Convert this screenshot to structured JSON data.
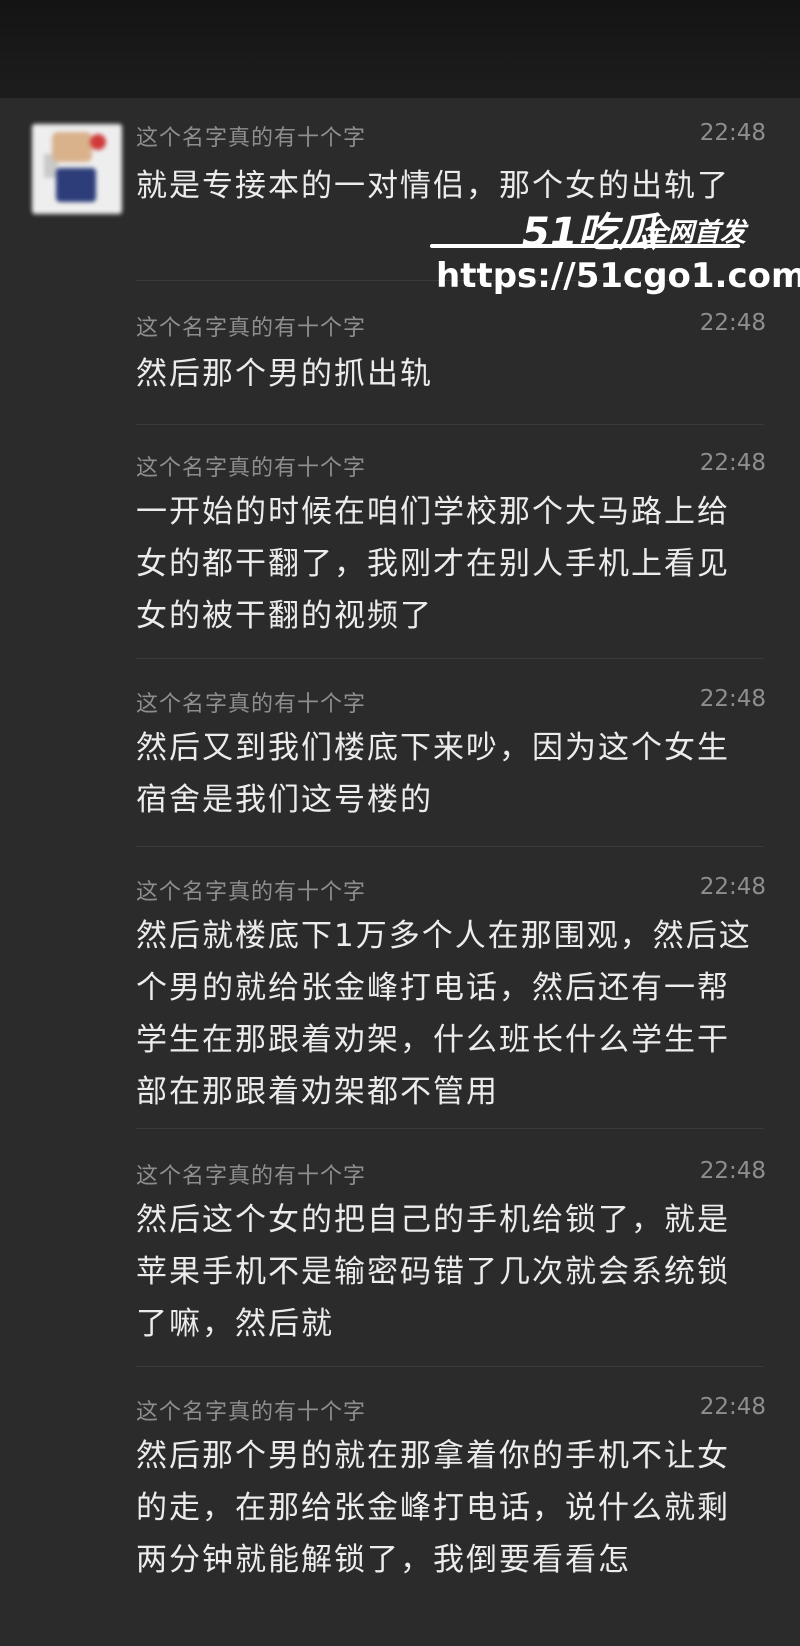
{
  "messages": [
    {
      "sender": "这个名字真的有十个字",
      "time": "22:48",
      "text": "就是专接本的一对情侣，那个女的出轨了"
    },
    {
      "sender": "这个名字真的有十个字",
      "time": "22:48",
      "text": "然后那个男的抓出轨"
    },
    {
      "sender": "这个名字真的有十个字",
      "time": "22:48",
      "text": "一开始的时候在咱们学校那个大马路上给女的都干翻了，我刚才在别人手机上看见女的被干翻的视频了"
    },
    {
      "sender": "这个名字真的有十个字",
      "time": "22:48",
      "text": "然后又到我们楼底下来吵，因为这个女生宿舍是我们这号楼的"
    },
    {
      "sender": "这个名字真的有十个字",
      "time": "22:48",
      "text": "然后就楼底下1万多个人在那围观，然后这个男的就给张金峰打电话，然后还有一帮学生在那跟着劝架，什么班长什么学生干部在那跟着劝架都不管用"
    },
    {
      "sender": "这个名字真的有十个字",
      "time": "22:48",
      "text": "然后这个女的把自己的手机给锁了，就是苹果手机不是输密码错了几次就会系统锁了嘛，然后就"
    },
    {
      "sender": "这个名字真的有十个字",
      "time": "22:48",
      "text": "然后那个男的就在那拿着你的手机不让女的走，在那给张金峰打电话，说什么就剩两分钟就能解锁了，我倒要看看怎"
    }
  ],
  "watermark": {
    "brand": "51吃瓜",
    "tagline": "全网首发",
    "url": "https://51cgo1.com"
  }
}
